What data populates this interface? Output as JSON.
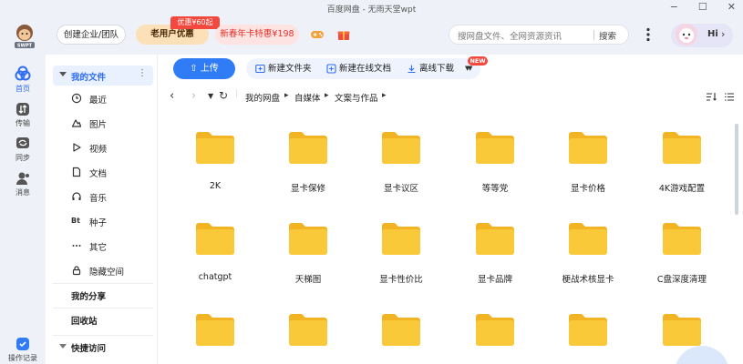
{
  "window": {
    "title": "百度网盘 - 无雨天堂wpt",
    "controls": [
      "−",
      "☐",
      "✕"
    ]
  },
  "header": {
    "logo_text": "SWPT",
    "corp_label": "创建企业/团队",
    "vip_label": "老用户优惠",
    "promo_tag": "优惠¥60起",
    "new_year_label": "新春年卡特惠¥198",
    "search_placeholder": "搜网盘文件、全网资源资讯",
    "search_button": "搜索",
    "user_greeting": "Hi"
  },
  "rail": [
    {
      "label": "首页",
      "icon": "home-icon",
      "active": true
    },
    {
      "label": "传输",
      "icon": "transfer-icon",
      "active": false
    },
    {
      "label": "同步",
      "icon": "sync-icon",
      "active": false
    },
    {
      "label": "消息",
      "icon": "message-icon",
      "active": false
    },
    {
      "label": "操作记录",
      "icon": "shield-icon",
      "active": false
    }
  ],
  "sidebar": {
    "my_files": "我的文件",
    "items": [
      {
        "label": "最近",
        "icon": "clock-icon"
      },
      {
        "label": "图片",
        "icon": "image-icon"
      },
      {
        "label": "视频",
        "icon": "video-icon"
      },
      {
        "label": "文档",
        "icon": "document-icon"
      },
      {
        "label": "音乐",
        "icon": "music-icon"
      },
      {
        "label": "种子",
        "icon": "bt-icon",
        "glyph": "Bt"
      },
      {
        "label": "其它",
        "icon": "more-icon"
      },
      {
        "label": "隐藏空间",
        "icon": "lock-icon"
      }
    ],
    "my_share": "我的分享",
    "recycle_bin": "回收站",
    "quick_access": "快捷访问"
  },
  "toolbar": {
    "upload": "上传",
    "new_folder": "新建文件夹",
    "new_online_doc": "新建在线文档",
    "new_tag": "NEW",
    "get_download": "离线下载"
  },
  "breadcrumb": [
    "我的网盘",
    "自媒体",
    "文案与作品"
  ],
  "files": [
    "2K",
    "显卡保修",
    "显卡议区",
    "等等党",
    "显卡价格",
    "4K游戏配置",
    "chatgpt",
    "天梯图",
    "显卡性价比",
    "显卡品牌",
    "梗战术核显卡",
    "C盘深度清理",
    "",
    "",
    "",
    "",
    "",
    ""
  ],
  "colors": {
    "accent": "#2f7cf6",
    "folder": "#f9c93a",
    "folder_tab": "#f2b422"
  }
}
